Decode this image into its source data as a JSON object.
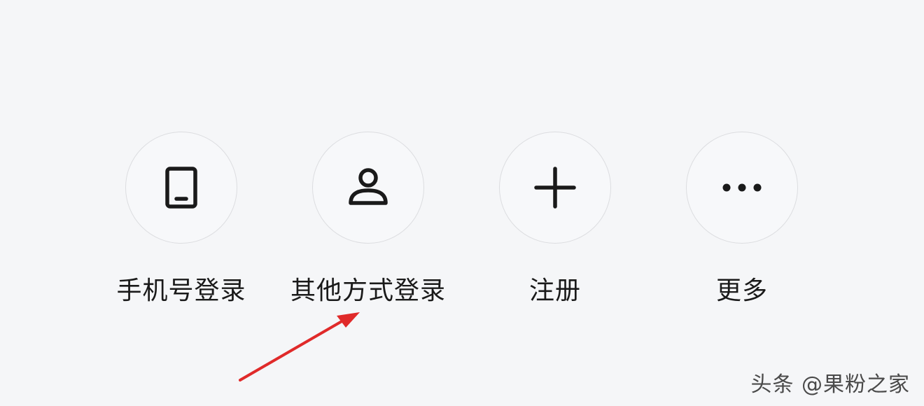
{
  "login_options": [
    {
      "label": "手机号登录",
      "icon": "phone-icon"
    },
    {
      "label": "其他方式登录",
      "icon": "user-icon"
    },
    {
      "label": "注册",
      "icon": "plus-icon"
    },
    {
      "label": "更多",
      "icon": "more-dots-icon"
    }
  ],
  "annotation": {
    "color": "#e02a2a",
    "icon": "red-arrow-icon"
  },
  "watermark": {
    "text": "头条 @果粉之家"
  },
  "colors": {
    "background": "#f5f6f8",
    "circle_border": "#dcdde0",
    "icon": "#1a1a1a"
  }
}
